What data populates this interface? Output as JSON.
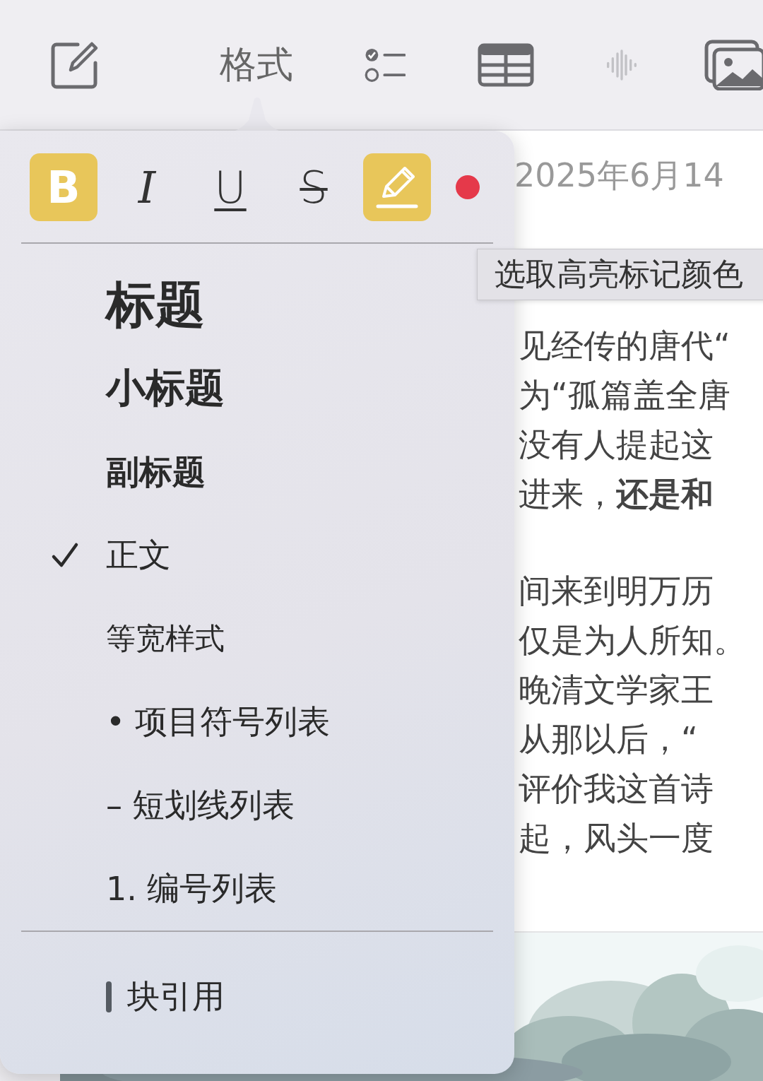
{
  "toolbar": {
    "items": [
      {
        "kind": "compose",
        "disabled": false
      },
      {
        "kind": "format",
        "label": "格式",
        "disabled": false
      },
      {
        "kind": "checklist",
        "disabled": false
      },
      {
        "kind": "table",
        "disabled": false
      },
      {
        "kind": "audio",
        "disabled": true
      },
      {
        "kind": "media",
        "disabled": false
      }
    ]
  },
  "format_popover": {
    "style_buttons": [
      {
        "kind": "bold",
        "label": "B",
        "selected": true
      },
      {
        "kind": "italic",
        "label": "I",
        "selected": false
      },
      {
        "kind": "underline",
        "label": "U",
        "selected": false
      },
      {
        "kind": "strikethrough",
        "label": "S",
        "selected": false
      },
      {
        "kind": "highlight",
        "selected": true
      },
      {
        "kind": "color",
        "color": "#e5394a"
      }
    ],
    "styles": [
      {
        "kind": "title",
        "label": "标题",
        "selected": false
      },
      {
        "kind": "heading",
        "label": "小标题",
        "selected": false
      },
      {
        "kind": "subheading",
        "label": "副标题",
        "selected": false
      },
      {
        "kind": "body",
        "label": "正文",
        "selected": true
      },
      {
        "kind": "monospaced",
        "label": "等宽样式",
        "selected": false
      },
      {
        "kind": "list",
        "marker": "•",
        "label": "项目符号列表",
        "selected": false
      },
      {
        "kind": "list",
        "marker": "–",
        "label": "短划线列表",
        "selected": false
      },
      {
        "kind": "list",
        "marker": "1.",
        "label": "编号列表",
        "selected": false
      }
    ],
    "block_quote": {
      "label": "块引用"
    }
  },
  "tooltip": {
    "text": "选取高亮标记颜色"
  },
  "note": {
    "date": "2025年6月14",
    "paragraphs": [
      [
        "见经传的唐代“",
        "为“孤篇盖全唐",
        "没有人提起这",
        "进来，**还是和**"
      ],
      [
        "间来到明万历",
        "仅是为人所知。",
        "晚清文学家王",
        "从那以后，“",
        "评价我这首诗",
        "起，风头一度"
      ]
    ]
  }
}
